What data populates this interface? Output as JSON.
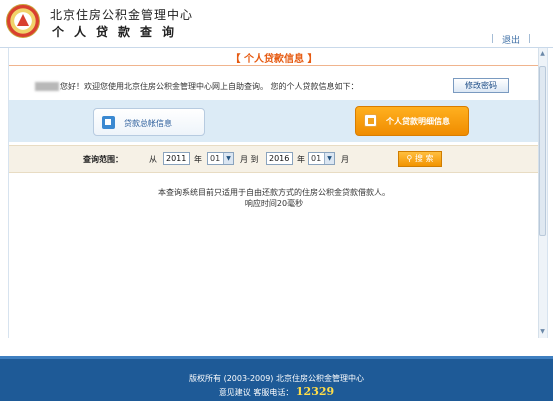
{
  "header": {
    "org_name": "北京住房公积金管理中心",
    "system_name": "个人贷款查询",
    "exit_label": "退出"
  },
  "section": {
    "title": "【 个人贷款信息 】"
  },
  "welcome": {
    "text": "您好！欢迎您使用北京住房公积金管理中心网上自助查询。 您的个人贷款信息如下：",
    "change_password_label": "修改密码"
  },
  "buttons": {
    "summary_label": "贷款总帐信息",
    "detail_label": "个人贷款明细信息"
  },
  "query": {
    "range_label": "查询范围：",
    "from_label": "从",
    "start_year": "2011",
    "year_label_1": "年",
    "start_month": "01",
    "month_to_label": "月 到",
    "end_year": "2016",
    "year_label_2": "年",
    "end_month": "01",
    "month_label": "月",
    "search_label": "搜 索"
  },
  "note": {
    "line1": "本查询系统目前只适用于自由还款方式的住房公积金贷款借款人。",
    "line2": "响应时间20毫秒"
  },
  "footer": {
    "copyright": "版权所有 (2003-2009) 北京住房公积金管理中心",
    "faint_link": "",
    "feedback_label": "意见建议",
    "hotline_label": "客服电话：",
    "hotline_number": "12329"
  }
}
